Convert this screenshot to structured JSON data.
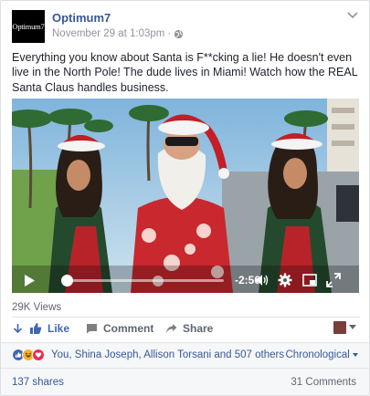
{
  "post": {
    "page_name": "Optimum7",
    "avatar_text": "Optimum7",
    "date": "November 29 at 1:03pm",
    "separator": "·",
    "privacy_icon": "globe-icon",
    "menu_icon": "chevron-down-icon",
    "text": "Everything you know about Santa is F**cking a lie! He doesn't even live in the North Pole! The dude lives in Miami! Watch how the REAL Santa Claus handles business."
  },
  "video": {
    "time_remaining": "-2:50",
    "progress_fraction": 0.05,
    "controls": [
      "play-icon",
      "volume-icon",
      "gear-icon",
      "pip-icon",
      "fullscreen-icon"
    ]
  },
  "views": "29K Views",
  "actions": {
    "like_label": "Like",
    "comment_label": "Comment",
    "share_label": "Share"
  },
  "reactions": {
    "icons": [
      "like-reaction",
      "haha-reaction",
      "love-reaction"
    ],
    "summary": "You, Shina Joseph, Allison Torsani and 507 others",
    "sort_label": "Chronological"
  },
  "counts": {
    "shares": "137 shares",
    "comments": "31 Comments"
  },
  "colors": {
    "link": "#365899",
    "like_blue": "#4267b2",
    "progress": "#4080ff"
  }
}
